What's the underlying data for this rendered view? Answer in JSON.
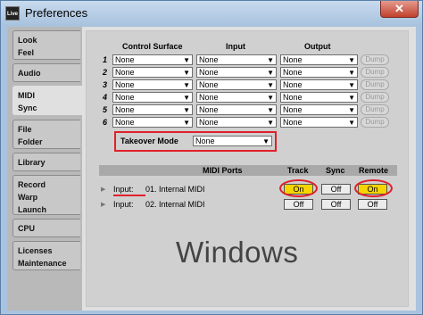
{
  "window": {
    "title": "Preferences",
    "app_icon": "Live",
    "close_label": "✕"
  },
  "sidebar": {
    "items": [
      {
        "label": "Look\nFeel"
      },
      {
        "label": "Audio"
      },
      {
        "label": "MIDI\nSync"
      },
      {
        "label": "File\nFolder"
      },
      {
        "label": "Library"
      },
      {
        "label": "Record\nWarp\nLaunch"
      },
      {
        "label": "CPU"
      },
      {
        "label": "Licenses\nMaintenance"
      }
    ],
    "active_index": 2
  },
  "control": {
    "headers": {
      "surface": "Control Surface",
      "input": "Input",
      "output": "Output"
    },
    "rows": [
      {
        "num": "1",
        "surface": "None",
        "input": "None",
        "output": "None",
        "dump": "Dump"
      },
      {
        "num": "2",
        "surface": "None",
        "input": "None",
        "output": "None",
        "dump": "Dump"
      },
      {
        "num": "3",
        "surface": "None",
        "input": "None",
        "output": "None",
        "dump": "Dump"
      },
      {
        "num": "4",
        "surface": "None",
        "input": "None",
        "output": "None",
        "dump": "Dump"
      },
      {
        "num": "5",
        "surface": "None",
        "input": "None",
        "output": "None",
        "dump": "Dump"
      },
      {
        "num": "6",
        "surface": "None",
        "input": "None",
        "output": "None",
        "dump": "Dump"
      }
    ]
  },
  "takeover": {
    "label": "Takeover Mode",
    "value": "None"
  },
  "midi_ports": {
    "headers": {
      "ports": "MIDI Ports",
      "track": "Track",
      "sync": "Sync",
      "remote": "Remote"
    },
    "rows": [
      {
        "io": "Input:",
        "name": "01. Internal MIDI",
        "track": "On",
        "sync": "Off",
        "remote": "On"
      },
      {
        "io": "Input:",
        "name": "02. Internal MIDI",
        "track": "Off",
        "sync": "Off",
        "remote": "Off"
      }
    ]
  },
  "watermark": "Windows",
  "colors": {
    "highlight": "#e0202a",
    "on_button": "#f6d400",
    "title_bar": "#a8c2de"
  }
}
